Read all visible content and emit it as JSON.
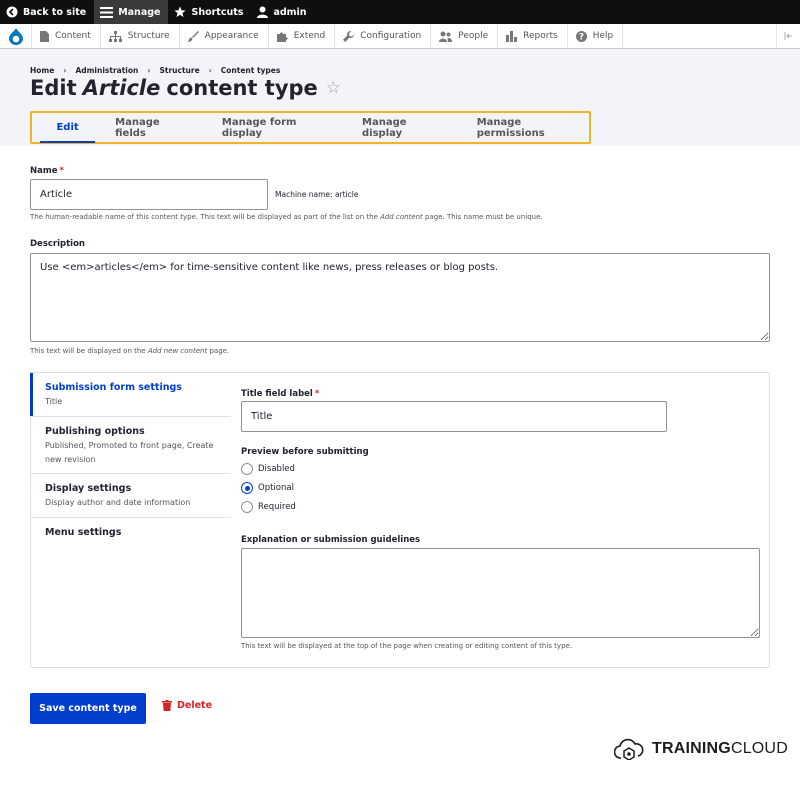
{
  "toolbar": {
    "back_to_site": "Back to site",
    "manage": "Manage",
    "shortcuts": "Shortcuts",
    "user": "admin"
  },
  "menu": {
    "items": [
      "Content",
      "Structure",
      "Appearance",
      "Extend",
      "Configuration",
      "People",
      "Reports",
      "Help"
    ]
  },
  "breadcrumb": [
    "Home",
    "Administration",
    "Structure",
    "Content types"
  ],
  "title": {
    "prefix": "Edit",
    "type_name": "Article",
    "suffix": "content type"
  },
  "tabs": [
    "Edit",
    "Manage fields",
    "Manage form display",
    "Manage display",
    "Manage permissions"
  ],
  "name_field": {
    "label": "Name",
    "value": "Article",
    "machine_name": "Machine name: article",
    "help_before": "The human-readable name of this content type. This text will be displayed as part of the list on the ",
    "help_em": "Add content",
    "help_after": " page. This name must be unique."
  },
  "description_field": {
    "label": "Description",
    "value": "Use <em>articles</em> for time-sensitive content like news, press releases or blog posts.",
    "help_before": "This text will be displayed on the ",
    "help_em": "Add new content",
    "help_after": " page."
  },
  "vertical_tabs": [
    {
      "title": "Submission form settings",
      "summary": "Title"
    },
    {
      "title": "Publishing options",
      "summary": "Published, Promoted to front page, Create new revision"
    },
    {
      "title": "Display settings",
      "summary": "Display author and date information"
    },
    {
      "title": "Menu settings",
      "summary": ""
    }
  ],
  "submission": {
    "title_label": "Title field label",
    "title_value": "Title",
    "preview_label": "Preview before submitting",
    "preview_options": [
      "Disabled",
      "Optional",
      "Required"
    ],
    "preview_selected": "Optional",
    "guidelines_label": "Explanation or submission guidelines",
    "guidelines_value": "",
    "guidelines_help": "This text will be displayed at the top of the page when creating or editing content of this type."
  },
  "actions": {
    "save": "Save content type",
    "delete": "Delete"
  },
  "brand": {
    "part1": "TRAINING",
    "part2": "CLOUD"
  },
  "colors": {
    "accent": "#003ecc",
    "highlight": "#f0b429",
    "danger": "#d72222",
    "header_bg": "#f3f4f9"
  }
}
